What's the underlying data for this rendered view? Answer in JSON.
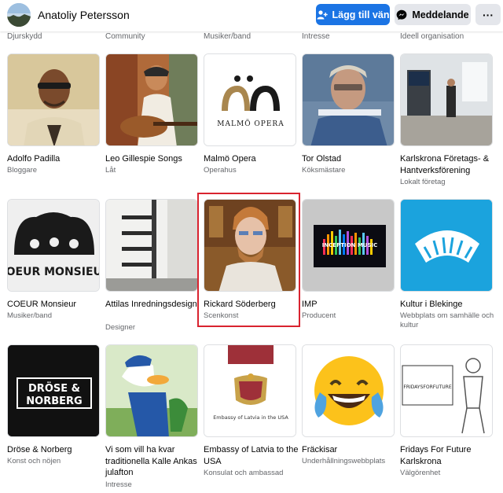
{
  "header": {
    "profile_name": "Anatoliy Petersson",
    "add_friend_label": "Lägg till vän",
    "message_label": "Meddelande",
    "more_label": "···"
  },
  "partial_row": [
    "Djurskydd",
    "Community",
    "Musiker/band",
    "Intresse",
    "Ideell organisation"
  ],
  "rows": [
    [
      {
        "title": "Adolfo Padilla",
        "category": "Bloggare"
      },
      {
        "title": "Leo Gillespie Songs",
        "category": "Låt"
      },
      {
        "title": "Malmö Opera",
        "category": "Operahus",
        "logo_text": "MALMÖ OPERA"
      },
      {
        "title": "Tor Olstad",
        "category": "Köksmästare"
      },
      {
        "title": "Karlskrona Företags- & Hantverksförening",
        "category": "Lokalt företag"
      }
    ],
    [
      {
        "title": "COEUR Monsieur",
        "category": "Musiker/band",
        "logo_text": "COEUR MONSIEUR"
      },
      {
        "title": "Attilas Inredningsdesign",
        "category": "Designer"
      },
      {
        "title": "Rickard Söderberg",
        "category": "Scenkonst"
      },
      {
        "title": "IMP",
        "category": "Producent",
        "logo_text": "INCEPTION MUSIC"
      },
      {
        "title": "Kultur i Blekinge",
        "category": "Webbplats om samhälle och kultur"
      }
    ],
    [
      {
        "title": "Dröse & Norberg",
        "category": "Konst och nöjen",
        "logo_line1": "DRÖSE &",
        "logo_line2": "NORBERG"
      },
      {
        "title": "Vi som vill ha kvar traditionella Kalle Ankas julafton",
        "category": "Intresse"
      },
      {
        "title": "Embassy of Latvia to the USA",
        "category": "Konsulat och ambassad",
        "logo_text": "Embassy of Latvia in the USA"
      },
      {
        "title": "Fräckisar",
        "category": "Underhållningswebbplats"
      },
      {
        "title": "Fridays For Future Karlskrona",
        "category": "Välgörenhet",
        "logo_text": "FRIDAYSFORFUTURE"
      }
    ]
  ],
  "colors": {
    "accent": "#1b74e4",
    "highlight": "#d9232f",
    "secondary_text": "#65676b"
  }
}
